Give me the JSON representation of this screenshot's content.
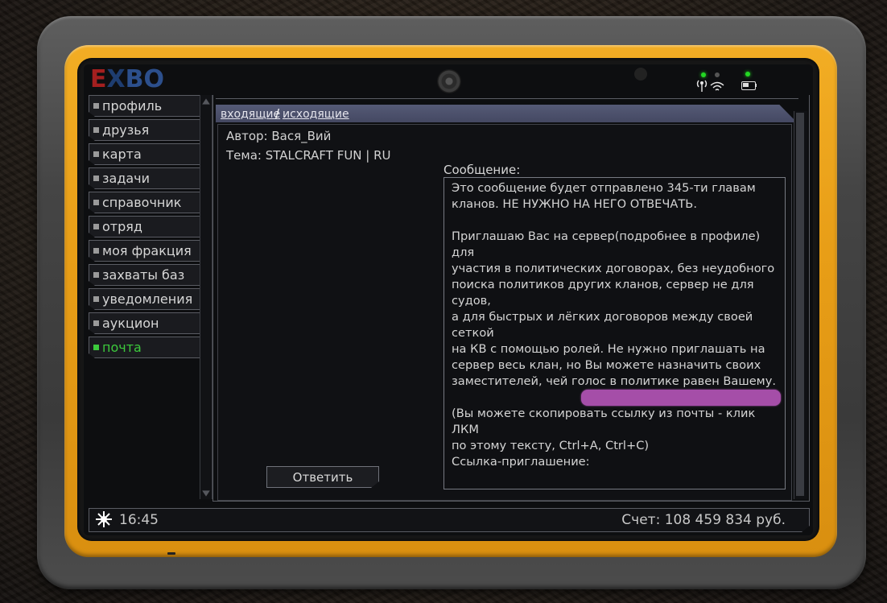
{
  "logo": {
    "part1": "E",
    "part2": "X",
    "part3": "BO"
  },
  "sidebar": {
    "items": [
      {
        "label": "профиль",
        "active": false
      },
      {
        "label": "друзья",
        "active": false
      },
      {
        "label": "карта",
        "active": false
      },
      {
        "label": "задачи",
        "active": false
      },
      {
        "label": "справочник",
        "active": false
      },
      {
        "label": "отряд",
        "active": false
      },
      {
        "label": "моя фракция",
        "active": false
      },
      {
        "label": "захваты баз",
        "active": false
      },
      {
        "label": "уведомления",
        "active": false
      },
      {
        "label": "аукцион",
        "active": false
      },
      {
        "label": "почта",
        "active": true
      }
    ]
  },
  "mail": {
    "tabs": {
      "incoming": "входящие",
      "separator": "/",
      "outgoing": "исходящие"
    },
    "author": "Автор: Вася_Вий",
    "subject": "Тема: STALCRAFT FUN | RU",
    "message_label": "Сообщение:",
    "message_body": "Это сообщение будет отправлено 345-ти главам\nкланов. НЕ НУЖНО НА НЕГО ОТВЕЧАТЬ.\n\nПриглашаю Вас на сервер(подробнее в профиле) для\nучастия в политических договорах, без неудобного\nпоиска политиков других кланов, сервер не для судов,\nа для быстрых и лёгких договоров между своей сеткой\nна КВ с помощью ролей. Не нужно приглашать на\nсервер весь клан, но Вы можете назначить своих\nзаместителей, чей голос в политике равен Вашему.\n\n(Вы можете скопировать ссылку из почты - клик ЛКМ\nпо этому тексту, Ctrl+A, Ctrl+C)\nСсылка-приглашение:",
    "reply_button": "Ответить"
  },
  "status_bar": {
    "time": "16:45",
    "balance": "Счет: 108 459 834 руб."
  },
  "colors": {
    "accent_green": "#3cc93c",
    "bezel_yellow": "#f2ad24",
    "tab_bar": "#555a76",
    "redaction": "#a54ea8"
  },
  "icons": [
    "camera-icon",
    "signal-icon",
    "wifi-icon",
    "battery-icon",
    "sun-icon"
  ]
}
